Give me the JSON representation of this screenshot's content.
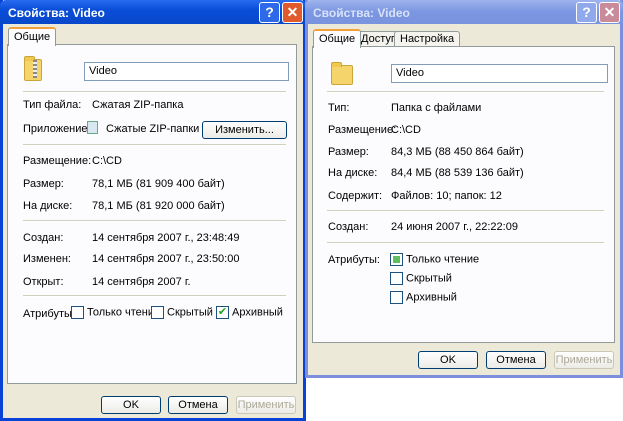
{
  "left": {
    "title": "Свойства: Video",
    "tabs": [
      "Общие"
    ],
    "name": "Video",
    "rows": {
      "type_label": "Тип файла:",
      "type": "Сжатая ZIP-папка",
      "app_label": "Приложение:",
      "app": "Сжатые ZIP-папки",
      "change_btn": "Изменить...",
      "loc_label": "Размещение:",
      "loc": "C:\\CD",
      "size_label": "Размер:",
      "size": "78,1 МБ (81 909 400 байт)",
      "disk_label": "На диске:",
      "disk": "78,1 МБ (81 920 000 байт)",
      "created_label": "Создан:",
      "created": "14 сентября 2007 г., 23:48:49",
      "modified_label": "Изменен:",
      "modified": "14 сентября 2007 г., 23:50:00",
      "opened_label": "Открыт:",
      "opened": "14 сентября 2007 г."
    },
    "attributes": {
      "label": "Атрибуты:",
      "readonly": "Только чтение",
      "hidden": "Скрытый",
      "archive": "Архивный"
    },
    "buttons": {
      "ok": "OK",
      "cancel": "Отмена",
      "apply": "Применить"
    }
  },
  "right": {
    "title": "Свойства: Video",
    "tabs": [
      "Общие",
      "Доступ",
      "Настройка"
    ],
    "name": "Video",
    "rows": {
      "type_label": "Тип:",
      "type": "Папка с файлами",
      "loc_label": "Размещение:",
      "loc": "C:\\CD",
      "size_label": "Размер:",
      "size": "84,3 МБ (88 450 864 байт)",
      "disk_label": "На диске:",
      "disk": "84,4 МБ (88 539 136 байт)",
      "contains_label": "Содержит:",
      "contains": "Файлов: 10; папок: 12",
      "created_label": "Создан:",
      "created": "24 июня 2007 г., 22:22:09"
    },
    "attributes": {
      "label": "Атрибуты:",
      "readonly": "Только чтение",
      "hidden": "Скрытый",
      "archive": "Архивный"
    },
    "buttons": {
      "ok": "OK",
      "cancel": "Отмена",
      "apply": "Применить"
    }
  }
}
